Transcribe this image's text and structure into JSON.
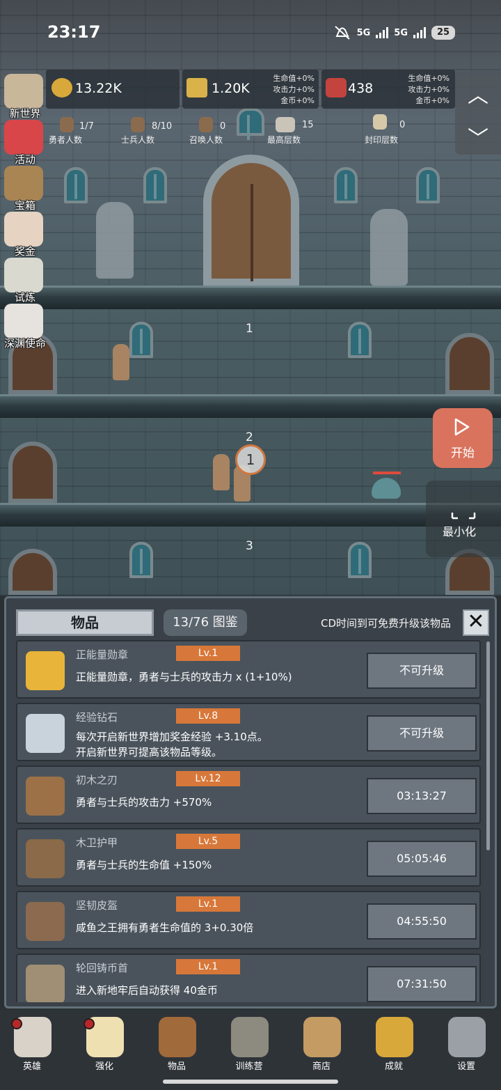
{
  "status_bar": {
    "time": "23:17",
    "network": "5G",
    "battery": "25"
  },
  "resources": {
    "gold": "13.22K",
    "bars": "1.20K",
    "gems": "438",
    "bonus_left": [
      "生命值+0%",
      "攻击力+0%",
      "金币+0%"
    ],
    "bonus_right": [
      "生命值+0%",
      "攻击力+0%",
      "金币+0%"
    ]
  },
  "stats": [
    {
      "value": "1/7",
      "label": "勇者人数"
    },
    {
      "value": "8/10",
      "label": "士兵人数"
    },
    {
      "value": "0",
      "label": "召唤人数"
    },
    {
      "value": "15",
      "label": "最高层数"
    },
    {
      "value": "0",
      "label": "封印层数"
    }
  ],
  "left_menu": [
    {
      "label": "新世界",
      "icon": "map-icon",
      "color": "#c9b79a"
    },
    {
      "label": "活动",
      "icon": "heart-icon",
      "color": "#d9464a"
    },
    {
      "label": "宝箱",
      "icon": "chest-icon",
      "color": "#a98554"
    },
    {
      "label": "奖金",
      "icon": "envelope-icon",
      "color": "#e6d3c2"
    },
    {
      "label": "试炼",
      "icon": "feather-icon",
      "color": "#d9d9d0"
    },
    {
      "label": "深渊使命",
      "icon": "pearl-icon",
      "color": "#e6e2de"
    }
  ],
  "scene": {
    "floors": [
      "1",
      "2",
      "3"
    ],
    "target_marker": "1",
    "start_label": "开始",
    "minimize_label": "最小化"
  },
  "panel": {
    "tab_label": "物品",
    "codex_label": "13/76 图鉴",
    "cd_hint": "CD时间到可免费升级该物品",
    "close_icon": "✕",
    "items": [
      {
        "name": "正能量勋章",
        "level": "Lv.1",
        "desc": [
          "正能量勋章，勇者与士兵的攻击力 x (1+10%)"
        ],
        "button": "不可升级",
        "icon": "crown-icon",
        "color": "#e8b53a"
      },
      {
        "name": "经验钻石",
        "level": "Lv.8",
        "desc": [
          "每次开启新世界增加奖金经验 +3.10点。",
          "开启新世界可提高该物品等级。"
        ],
        "button": "不可升级",
        "icon": "diamond-icon",
        "color": "#c9d3dc"
      },
      {
        "name": "初木之刃",
        "level": "Lv.12",
        "desc": [
          "勇者与士兵的攻击力 +570%"
        ],
        "button": "03:13:27",
        "icon": "wooden-sword-icon",
        "color": "#9c7147"
      },
      {
        "name": "木卫护甲",
        "level": "Lv.5",
        "desc": [
          "勇者与士兵的生命值 +150%"
        ],
        "button": "05:05:46",
        "icon": "wood-armor-icon",
        "color": "#8a6a48"
      },
      {
        "name": "坚韧皮盔",
        "level": "Lv.1",
        "desc": [
          "咸鱼之王拥有勇者生命值的 3+0.30倍"
        ],
        "button": "04:55:50",
        "icon": "leather-helmet-icon",
        "color": "#8b6a4f"
      },
      {
        "name": "轮回铸币首",
        "level": "Lv.1",
        "desc": [
          "进入新地牢后自动获得 40金币"
        ],
        "button": "07:31:50",
        "icon": "knight-helmet-icon",
        "color": "#a08f74"
      }
    ]
  },
  "bottom_nav": [
    {
      "label": "英雄",
      "icon": "skull-icon",
      "color": "#d8d2c8",
      "dot": true
    },
    {
      "label": "强化",
      "icon": "candle-icon",
      "color": "#efe0b2",
      "dot": true
    },
    {
      "label": "物品",
      "icon": "book-icon",
      "color": "#a06a3a",
      "dot": false
    },
    {
      "label": "训练营",
      "icon": "lantern-icon",
      "color": "#8d8a80",
      "dot": false
    },
    {
      "label": "商店",
      "icon": "beer-mug-icon",
      "color": "#c49b62",
      "dot": false
    },
    {
      "label": "成就",
      "icon": "key-icon",
      "color": "#d8a83a",
      "dot": false
    },
    {
      "label": "设置",
      "icon": "gear-icon",
      "color": "#9aa0a6",
      "dot": false
    }
  ]
}
